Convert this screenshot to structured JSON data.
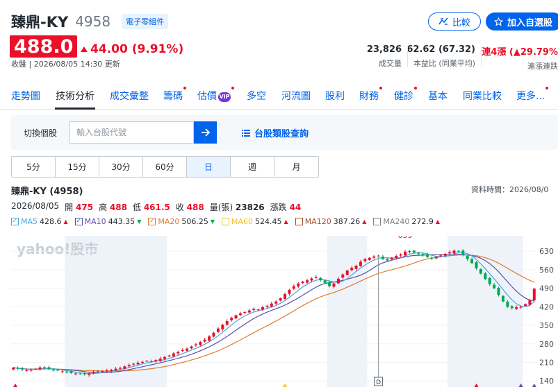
{
  "header": {
    "name": "臻鼎-KY",
    "code": "4958",
    "sector": "電子零組件",
    "compare_label": "比較",
    "watch_label": "加入自選股"
  },
  "quote": {
    "price": "488.0",
    "change": "44.00 (9.91%)",
    "close_time": "收盤 | 2026/08/05 14:30 更新"
  },
  "stats": [
    {
      "value": "23,826",
      "label": "成交量",
      "color": "#232a31"
    },
    {
      "value": "62.62 (67.32)",
      "label": "本益比 (同業平均)",
      "color": "#232a31"
    },
    {
      "value": "連4漲 (▲29.79%",
      "label": "連漲連跌",
      "color": "#eb0f29"
    }
  ],
  "nav": [
    {
      "label": "走勢圖",
      "dot": false
    },
    {
      "label": "技術分析",
      "dot": false,
      "active": true
    },
    {
      "label": "成交彙整",
      "dot": false
    },
    {
      "label": "籌碼",
      "dot": true
    },
    {
      "label": "估價",
      "dot": true,
      "vip": "VIP"
    },
    {
      "label": "多空",
      "dot": false
    },
    {
      "label": "河流圖",
      "dot": false
    },
    {
      "label": "股利",
      "dot": false
    },
    {
      "label": "財務",
      "dot": true
    },
    {
      "label": "健診",
      "dot": true
    },
    {
      "label": "基本",
      "dot": false
    },
    {
      "label": "同業比較",
      "dot": false
    },
    {
      "label": "更多...",
      "dot": true
    }
  ],
  "search": {
    "label": "切換個股",
    "placeholder": "輸入台股代號",
    "sector_link": "台股類股查詢"
  },
  "periods": [
    "5分",
    "15分",
    "30分",
    "60分",
    "日",
    "週",
    "月"
  ],
  "active_period": "日",
  "chart_header": {
    "title": "臻鼎-KY (4958)",
    "data_time": "資料時間：2026/08/0",
    "date": "2026/08/05",
    "open_label": "開",
    "open": "475",
    "high_label": "高",
    "high": "488",
    "low_label": "低",
    "low": "461.5",
    "close_label": "收",
    "close": "488",
    "volume_label": "量(張)",
    "volume": "23826",
    "change_label": "漲跌",
    "change": "44"
  },
  "ma": [
    {
      "name": "MA5",
      "value": "428.6",
      "dir": "up",
      "color": "#4aa4e0",
      "checked": true
    },
    {
      "name": "MA10",
      "value": "443.35",
      "dir": "down",
      "color": "#5850a8",
      "checked": true
    },
    {
      "name": "MA20",
      "value": "506.25",
      "dir": "down",
      "color": "#e07a2e",
      "checked": true
    },
    {
      "name": "MA60",
      "value": "524.45",
      "dir": "up",
      "color": "#f3bf2a",
      "checked": false
    },
    {
      "name": "MA120",
      "value": "387.26",
      "dir": "up",
      "color": "#a0522d",
      "checked": false
    },
    {
      "name": "MA240",
      "value": "272.9",
      "dir": "up",
      "color": "#7f7f7f",
      "checked": false
    }
  ],
  "chart_data": {
    "type": "candlestick",
    "y_ticks": [
      630,
      560,
      490,
      420,
      350,
      280,
      210,
      140
    ],
    "ylim": [
      117,
      688
    ],
    "annotations": [
      {
        "text": "659",
        "value": 659,
        "index": 88
      },
      {
        "text": "157.5",
        "value": 157.5,
        "index": 16
      }
    ],
    "marker_label": "D",
    "watermark": "yahoo!股市",
    "colors": {
      "up": "#eb0f29",
      "down": "#00a854",
      "ma5": "#4aa4e0",
      "ma10": "#5850a8",
      "ma20": "#e07a2e"
    },
    "closes": [
      190,
      186,
      183,
      180,
      182,
      186,
      191,
      188,
      184,
      181,
      179,
      176,
      174,
      170,
      168,
      166,
      165,
      168,
      173,
      175,
      177,
      180,
      182,
      186,
      189,
      195,
      200,
      205,
      209,
      212,
      216,
      214,
      219,
      224,
      230,
      236,
      244,
      250,
      256,
      262,
      270,
      278,
      287,
      296,
      308,
      322,
      338,
      352,
      366,
      378,
      388,
      395,
      400,
      406,
      412,
      410,
      418,
      424,
      432,
      440,
      452,
      468,
      484,
      498,
      508,
      515,
      520,
      527,
      532,
      520,
      510,
      498,
      508,
      526,
      542,
      557,
      567,
      575,
      590,
      600,
      605,
      610,
      612,
      600,
      595,
      605,
      612,
      618,
      628,
      630,
      625,
      620,
      615,
      608,
      602,
      608,
      614,
      620,
      626,
      632,
      630,
      615,
      600,
      585,
      565,
      545,
      525,
      505,
      490,
      465,
      440,
      420,
      415,
      418,
      420,
      430,
      444,
      488
    ],
    "shaded_ranges": [
      [
        12,
        35
      ],
      [
        71,
        80
      ],
      [
        98,
        115
      ]
    ],
    "marker_index": 82,
    "bottom_markers": [
      {
        "index": 0,
        "color": "#eb0f29"
      },
      {
        "index": 61,
        "color": "#f3bf2a"
      },
      {
        "index": 104,
        "color": "#eb0f29"
      },
      {
        "index": 114,
        "color": "#5850a8"
      },
      {
        "index": 118,
        "color": "#5850a8"
      }
    ]
  }
}
